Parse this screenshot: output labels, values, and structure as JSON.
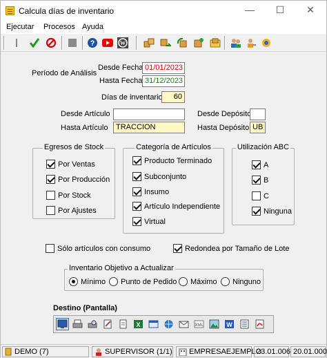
{
  "window": {
    "title": "Calcula días de inventario",
    "minimize_glyph": "—",
    "maximize_glyph": "☐",
    "close_glyph": "✕"
  },
  "menu": [
    "Ejecutar",
    "Procesos",
    "Ayuda"
  ],
  "toolbar": {
    "icons": [
      "pin-icon",
      "check-icon",
      "cancel-icon",
      "stop-icon",
      "help-icon",
      "youtube-icon",
      "wordpress-icon",
      "boxes-icon",
      "transfer-icon",
      "recycle-icon",
      "config-box-icon",
      "folder-box-icon",
      "users-icon",
      "user-key-icon",
      "globe-user-icon"
    ]
  },
  "periodo": {
    "label": "Período de Análisis",
    "desde_label": "Desde Fecha",
    "desde_value": "01/01/2023",
    "hasta_label": "Hasta Fecha",
    "hasta_value": "31/12/2023"
  },
  "dias": {
    "label": "Días de inventario",
    "value": "60"
  },
  "articulo": {
    "desde_label": "Desde Artículo",
    "desde_value": "",
    "hasta_label": "Hasta Artículo",
    "hasta_value": "TRACCION"
  },
  "deposito": {
    "desde_label": "Desde Depósito",
    "desde_value": "",
    "hasta_label": "Hasta Depósito",
    "hasta_value": "UB"
  },
  "egresos": {
    "title": "Egresos de Stock",
    "items": [
      {
        "label": "Por Ventas",
        "checked": true
      },
      {
        "label": "Por Producción",
        "checked": true
      },
      {
        "label": "Por Stock",
        "checked": false
      },
      {
        "label": "Por Ajustes",
        "checked": false
      }
    ]
  },
  "categoria": {
    "title": "Categoría de Artículos",
    "items": [
      {
        "label": "Producto Terminado",
        "checked": true
      },
      {
        "label": "Subconjunto",
        "checked": true
      },
      {
        "label": "Insumo",
        "checked": true
      },
      {
        "label": "Artículo Independiente",
        "checked": true
      },
      {
        "label": "Virtual",
        "checked": true
      }
    ]
  },
  "abc": {
    "title": "Utilización ABC",
    "items": [
      {
        "label": "A",
        "checked": true
      },
      {
        "label": "B",
        "checked": true
      },
      {
        "label": "C",
        "checked": false
      },
      {
        "label": "Ninguna",
        "checked": true
      }
    ]
  },
  "options": {
    "solo_consumo": {
      "label": "Sólo artículos con consumo",
      "checked": false
    },
    "redondea": {
      "label": "Redondea por Tamaño de Lote",
      "checked": true
    }
  },
  "objetivo": {
    "title": "Inventario Objetivo a Actualizar",
    "items": [
      {
        "label": "Mínimo",
        "selected": true
      },
      {
        "label": "Punto de Pedido",
        "selected": false
      },
      {
        "label": "Máximo",
        "selected": false
      },
      {
        "label": "Ninguno",
        "selected": false
      }
    ]
  },
  "destino": {
    "title": "Destino (Pantalla)",
    "icons": [
      "screen-icon",
      "printer-icon",
      "print-preview-icon",
      "edit-doc-icon",
      "text-file-icon",
      "excel-icon",
      "window-icon",
      "web-icon",
      "email-icon",
      "xml-icon",
      "image-icon",
      "word-icon",
      "list-icon",
      "pdf-icon"
    ]
  },
  "status": {
    "empresa_demo": "DEMO (7)",
    "user": "SUPERVISOR (1/1)",
    "empresa": "EMPRESAEJEMPLO",
    "version1": "23.01.006",
    "version2": "20.01.000"
  },
  "colors": {
    "date_from": "#d40000",
    "date_to": "#0a8a0a",
    "highlight_field": "#fff8c4"
  }
}
